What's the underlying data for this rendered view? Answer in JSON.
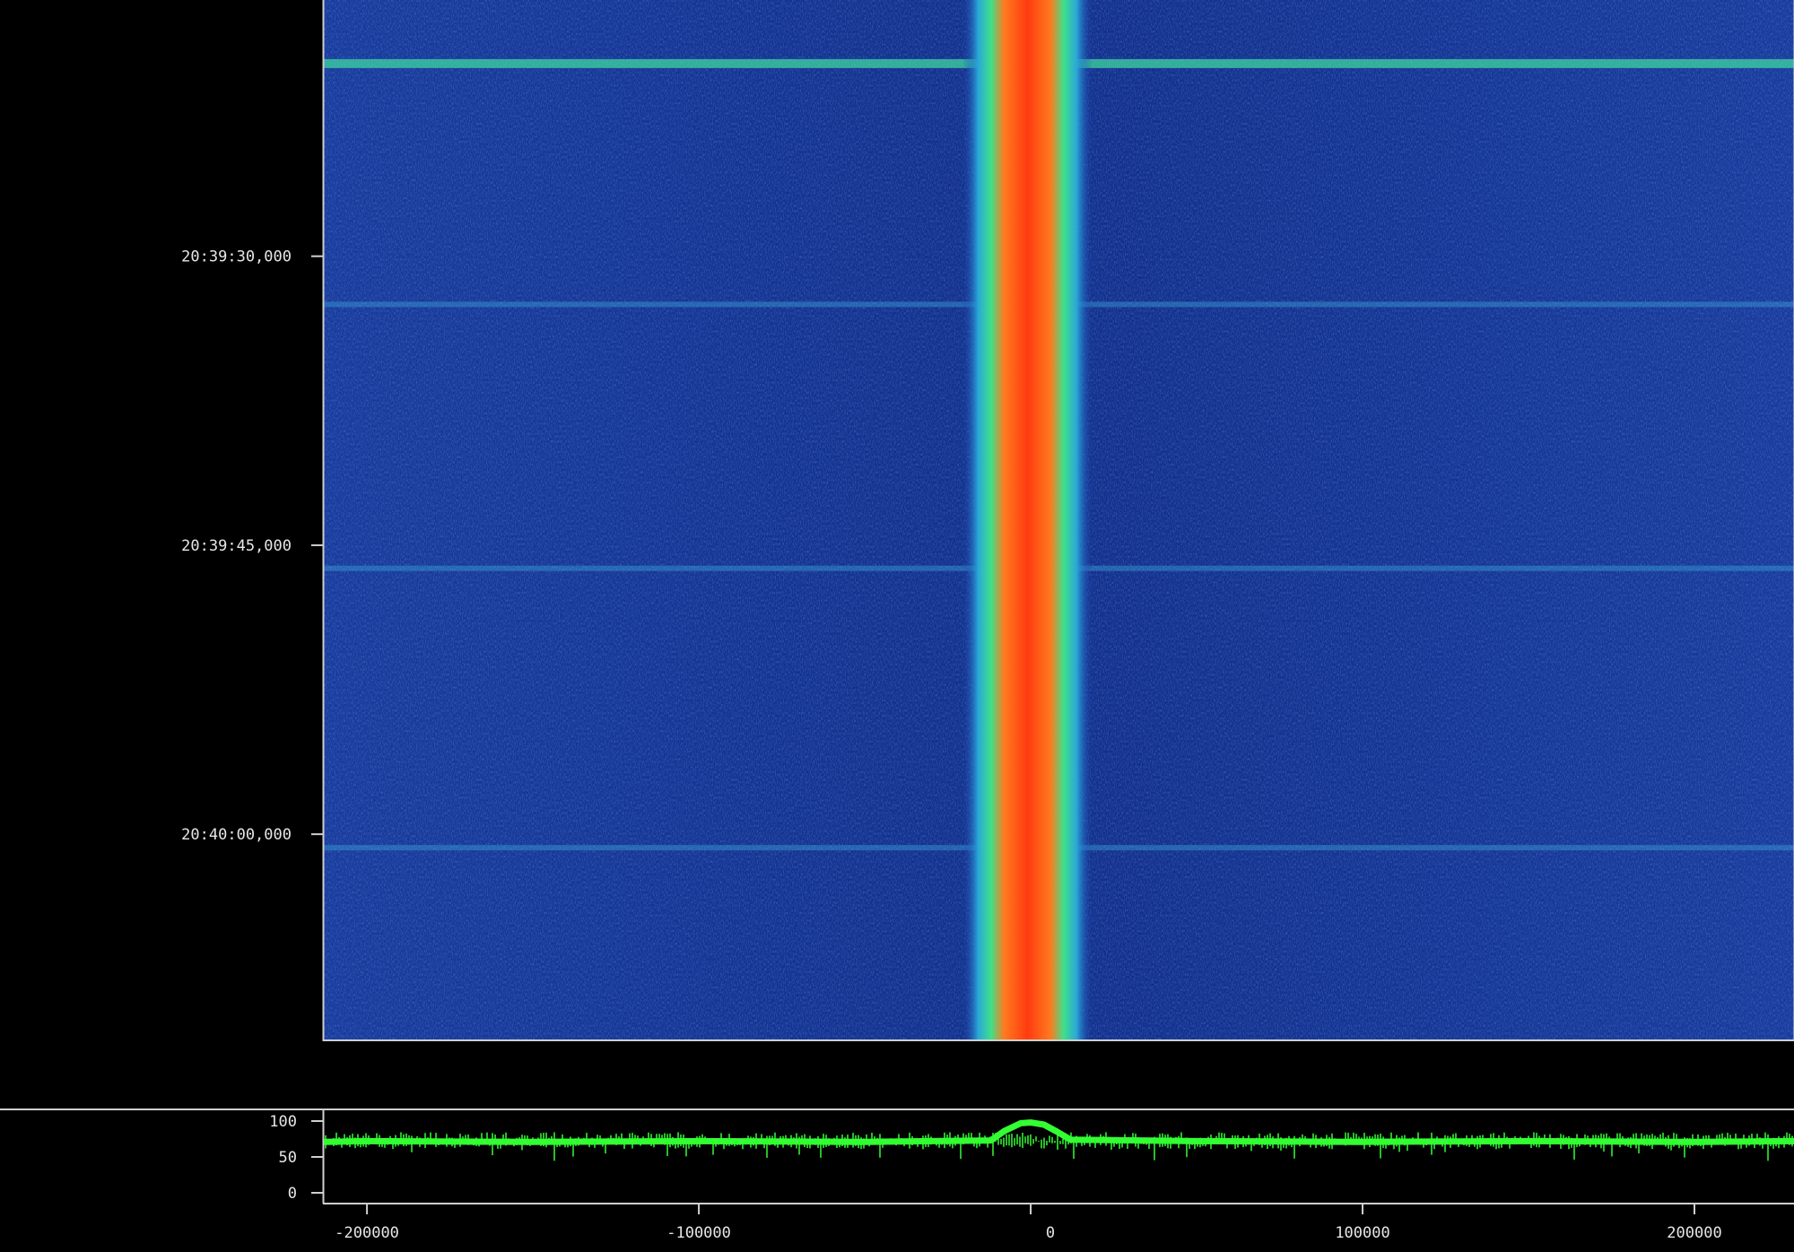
{
  "chart_data": [
    {
      "type": "heatmap",
      "title": "",
      "xlabel": "",
      "ylabel": "",
      "y_ticks": [
        "20:39:30,000",
        "20:39:45,000",
        "20:40:00,000"
      ],
      "y_tick_values_s": [
        30,
        45,
        60
      ],
      "y_range_s": [
        16.7,
        70.7
      ],
      "x_range": [
        -213000,
        230000
      ],
      "colormap": [
        "#0a1a6e",
        "#1c3fb0",
        "#2aa8d8",
        "#3fe08a",
        "#e8e63a",
        "#ff7a1e",
        "#ff3b10"
      ],
      "carrier": {
        "center_offset": -1000,
        "width": 15000
      },
      "horizontal_lines_s": [
        20.0,
        32.5,
        46.2,
        60.7
      ]
    },
    {
      "type": "line",
      "title": "",
      "xlabel": "",
      "ylabel": "",
      "x": [
        -213000,
        -200000,
        -150000,
        -100000,
        -50000,
        -12000,
        -8000,
        -3000,
        0,
        4000,
        8000,
        12000,
        50000,
        100000,
        150000,
        200000,
        230000
      ],
      "series": [
        {
          "values": [
            71,
            72,
            71,
            72,
            71,
            73,
            86,
            97,
            98,
            95,
            85,
            74,
            72,
            71,
            72,
            71,
            72
          ]
        }
      ],
      "x_ticks": [
        "-200000",
        "-100000",
        "0",
        "100000",
        "200000"
      ],
      "x_tick_values": [
        -200000,
        -100000,
        0,
        100000,
        200000
      ],
      "y_ticks": [
        "100",
        "50",
        "0"
      ],
      "y_tick_values": [
        100,
        50,
        0
      ],
      "ylim": [
        0,
        100
      ],
      "line_color": "#33ff33"
    }
  ]
}
